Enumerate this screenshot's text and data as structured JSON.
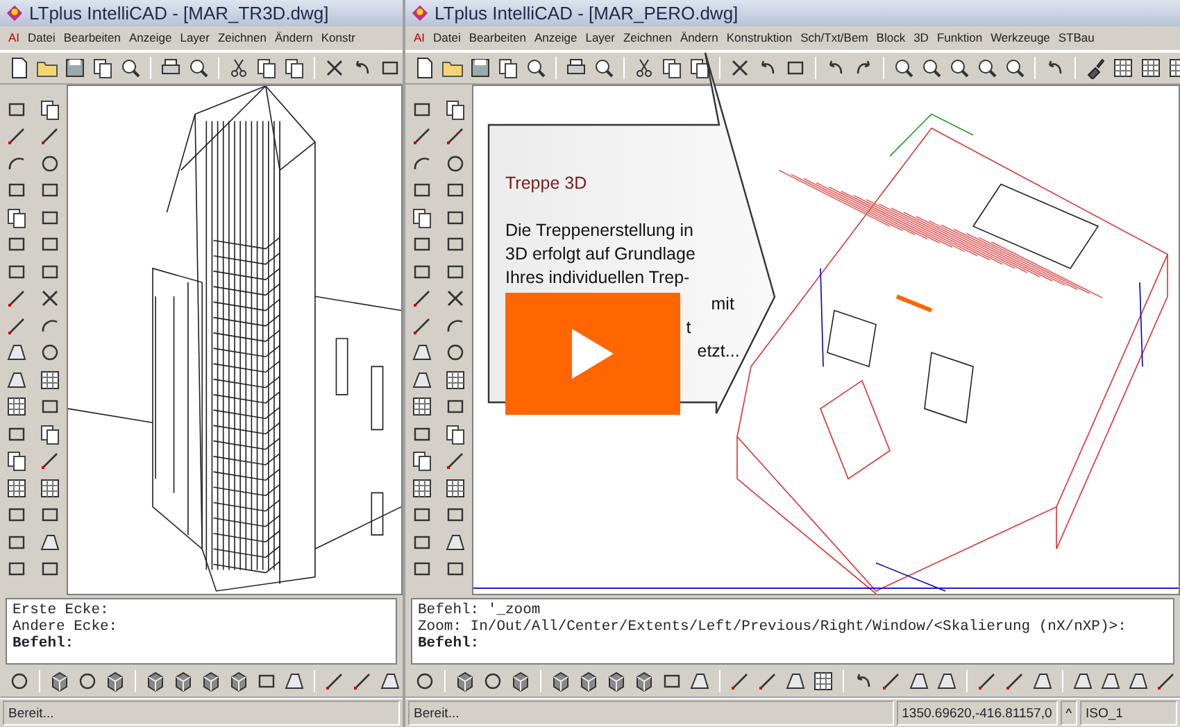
{
  "windows": [
    {
      "title": "LTplus IntelliCAD - [MAR_TR3D.dwg]",
      "menu": [
        "AI",
        "Datei",
        "Bearbeiten",
        "Anzeige",
        "Layer",
        "Zeichnen",
        "Ändern",
        "Konstr"
      ],
      "command_lines": [
        {
          "text": "Erste Ecke:",
          "kind": "history"
        },
        {
          "text": "Andere Ecke:",
          "kind": "history"
        },
        {
          "text": "Befehl:",
          "kind": "prompt"
        }
      ],
      "status": {
        "message": "Bereit..."
      }
    },
    {
      "title": "LTplus IntelliCAD - [MAR_PERO.dwg]",
      "menu": [
        "AI",
        "Datei",
        "Bearbeiten",
        "Anzeige",
        "Layer",
        "Zeichnen",
        "Ändern",
        "Konstruktion",
        "Sch/Txt/Bem",
        "Block",
        "3D",
        "Funktion",
        "Werkzeuge",
        "STBau"
      ],
      "command_lines": [
        {
          "text": "Befehl: '_zoom",
          "kind": "history"
        },
        {
          "text": "Zoom:  In/Out/All/Center/Extents/Left/Previous/Right/Window/<Skalierung (nX/nXP)>:",
          "kind": "history"
        },
        {
          "text": "Befehl:",
          "kind": "prompt"
        }
      ],
      "status": {
        "message": "Bereit...",
        "coordinates": "1350.69620,-416.81157,0",
        "caret": "^",
        "text_style": "ISO_1"
      }
    }
  ],
  "callout": {
    "title": "Treppe 3D",
    "lines": [
      "Die Treppenerstellung in",
      "3D erfolgt auf Grundlage",
      "Ihres individuellen Trep-"
    ],
    "fragments": [
      "mit",
      "t",
      "etzt..."
    ]
  },
  "play_overlay": true
}
